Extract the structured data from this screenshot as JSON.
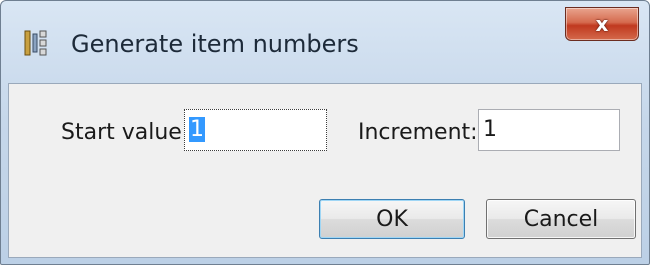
{
  "window": {
    "title": "Generate item numbers",
    "icon": "numbering-icon",
    "close_label": "x"
  },
  "form": {
    "start_label": "Start value:",
    "start_value": "1",
    "increment_label": "Increment:",
    "increment_value": "1"
  },
  "buttons": {
    "ok_label": "OK",
    "cancel_label": "Cancel"
  },
  "colors": {
    "titlebar": "#c6d7ea",
    "close_button": "#c0391f",
    "selection": "#3399ff",
    "default_button_border": "#3c7fb1"
  }
}
